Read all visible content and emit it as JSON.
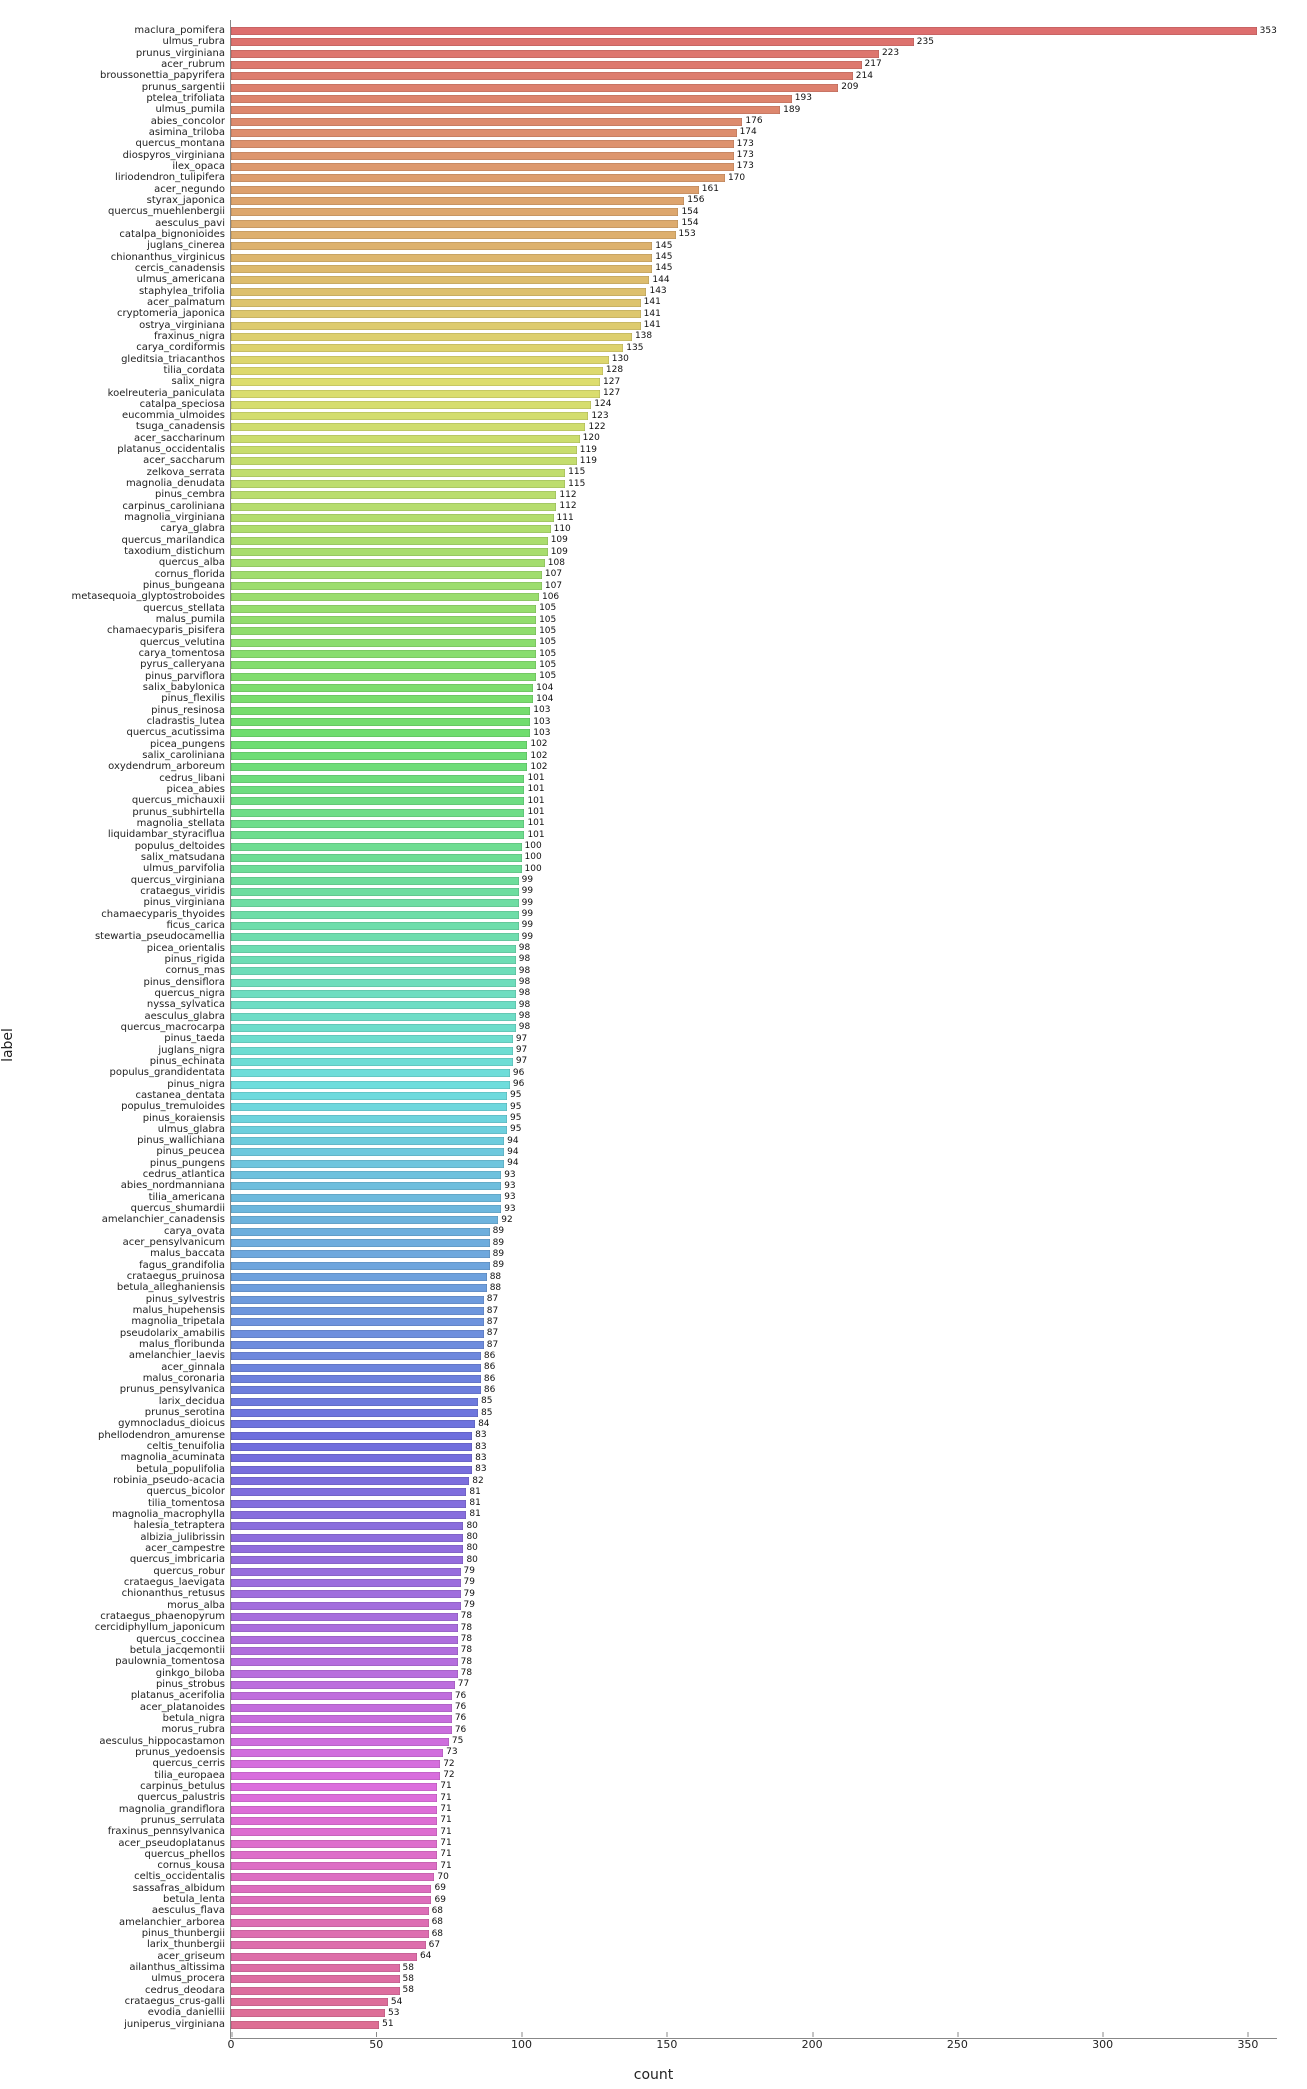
{
  "axis": {
    "xlabel": "count",
    "ylabel": "label",
    "x_ticks": [
      0,
      50,
      100,
      150,
      200,
      250,
      300,
      350
    ],
    "x_max": 360
  },
  "chart_data": {
    "type": "bar",
    "orientation": "horizontal",
    "title": "",
    "xlabel": "count",
    "ylabel": "label",
    "xlim": [
      0,
      360
    ],
    "categories": [
      "maclura_pomifera",
      "ulmus_rubra",
      "prunus_virginiana",
      "acer_rubrum",
      "broussonettia_papyrifera",
      "prunus_sargentii",
      "ptelea_trifoliata",
      "ulmus_pumila",
      "abies_concolor",
      "asimina_triloba",
      "quercus_montana",
      "diospyros_virginiana",
      "ilex_opaca",
      "liriodendron_tulipifera",
      "acer_negundo",
      "styrax_japonica",
      "quercus_muehlenbergii",
      "aesculus_pavi",
      "catalpa_bignonioides",
      "juglans_cinerea",
      "chionanthus_virginicus",
      "cercis_canadensis",
      "ulmus_americana",
      "staphylea_trifolia",
      "acer_palmatum",
      "cryptomeria_japonica",
      "ostrya_virginiana",
      "fraxinus_nigra",
      "carya_cordiformis",
      "gleditsia_triacanthos",
      "tilia_cordata",
      "salix_nigra",
      "koelreuteria_paniculata",
      "catalpa_speciosa",
      "eucommia_ulmoides",
      "tsuga_canadensis",
      "acer_saccharinum",
      "platanus_occidentalis",
      "acer_saccharum",
      "zelkova_serrata",
      "magnolia_denudata",
      "pinus_cembra",
      "carpinus_caroliniana",
      "magnolia_virginiana",
      "carya_glabra",
      "quercus_marilandica",
      "taxodium_distichum",
      "quercus_alba",
      "cornus_florida",
      "pinus_bungeana",
      "metasequoia_glyptostroboides",
      "quercus_stellata",
      "malus_pumila",
      "chamaecyparis_pisifera",
      "quercus_velutina",
      "carya_tomentosa",
      "pyrus_calleryana",
      "pinus_parviflora",
      "salix_babylonica",
      "pinus_flexilis",
      "pinus_resinosa",
      "cladrastis_lutea",
      "quercus_acutissima",
      "picea_pungens",
      "salix_caroliniana",
      "oxydendrum_arboreum",
      "cedrus_libani",
      "picea_abies",
      "quercus_michauxii",
      "prunus_subhirtella",
      "magnolia_stellata",
      "liquidambar_styraciflua",
      "populus_deltoides",
      "salix_matsudana",
      "ulmus_parvifolia",
      "quercus_virginiana",
      "crataegus_viridis",
      "pinus_virginiana",
      "chamaecyparis_thyoides",
      "ficus_carica",
      "stewartia_pseudocamellia",
      "picea_orientalis",
      "pinus_rigida",
      "cornus_mas",
      "pinus_densiflora",
      "quercus_nigra",
      "nyssa_sylvatica",
      "aesculus_glabra",
      "quercus_macrocarpa",
      "pinus_taeda",
      "juglans_nigra",
      "pinus_echinata",
      "populus_grandidentata",
      "pinus_nigra",
      "castanea_dentata",
      "populus_tremuloides",
      "pinus_koraiensis",
      "ulmus_glabra",
      "pinus_wallichiana",
      "pinus_peucea",
      "pinus_pungens",
      "cedrus_atlantica",
      "abies_nordmanniana",
      "tilia_americana",
      "quercus_shumardii",
      "amelanchier_canadensis",
      "carya_ovata",
      "acer_pensylvanicum",
      "malus_baccata",
      "fagus_grandifolia",
      "crataegus_pruinosa",
      "betula_alleghaniensis",
      "pinus_sylvestris",
      "malus_hupehensis",
      "magnolia_tripetala",
      "pseudolarix_amabilis",
      "malus_floribunda",
      "amelanchier_laevis",
      "acer_ginnala",
      "malus_coronaria",
      "prunus_pensylvanica",
      "larix_decidua",
      "prunus_serotina",
      "gymnocladus_dioicus",
      "phellodendron_amurense",
      "celtis_tenuifolia",
      "magnolia_acuminata",
      "betula_populifolia",
      "robinia_pseudo-acacia",
      "quercus_bicolor",
      "tilia_tomentosa",
      "magnolia_macrophylla",
      "halesia_tetraptera",
      "albizia_julibrissin",
      "acer_campestre",
      "quercus_imbricaria",
      "quercus_robur",
      "crataegus_laevigata",
      "chionanthus_retusus",
      "morus_alba",
      "crataegus_phaenopyrum",
      "cercidiphyllum_japonicum",
      "quercus_coccinea",
      "betula_jacqemontii",
      "paulownia_tomentosa",
      "ginkgo_biloba",
      "pinus_strobus",
      "platanus_acerifolia",
      "acer_platanoides",
      "betula_nigra",
      "morus_rubra",
      "aesculus_hippocastamon",
      "prunus_yedoensis",
      "quercus_cerris",
      "tilia_europaea",
      "carpinus_betulus",
      "quercus_palustris",
      "magnolia_grandiflora",
      "prunus_serrulata",
      "fraxinus_pennsylvanica",
      "acer_pseudoplatanus",
      "quercus_phellos",
      "cornus_kousa",
      "celtis_occidentalis",
      "sassafras_albidum",
      "betula_lenta",
      "aesculus_flava",
      "amelanchier_arborea",
      "pinus_thunbergii",
      "larix_thunbergii",
      "acer_griseum",
      "ailanthus_altissima",
      "ulmus_procera",
      "cedrus_deodara",
      "crataegus_crus-galli",
      "evodia_daniellii",
      "juniperus_virginiana"
    ],
    "values": [
      353,
      235,
      223,
      217,
      214,
      209,
      193,
      189,
      176,
      174,
      173,
      173,
      173,
      170,
      161,
      156,
      154,
      154,
      153,
      145,
      145,
      145,
      144,
      143,
      141,
      141,
      141,
      138,
      135,
      130,
      128,
      127,
      127,
      124,
      123,
      122,
      120,
      119,
      119,
      115,
      115,
      112,
      112,
      111,
      110,
      109,
      109,
      108,
      107,
      107,
      106,
      105,
      105,
      105,
      105,
      105,
      105,
      105,
      104,
      104,
      103,
      103,
      103,
      102,
      102,
      102,
      101,
      101,
      101,
      101,
      101,
      101,
      100,
      100,
      100,
      99,
      99,
      99,
      99,
      99,
      99,
      98,
      98,
      98,
      98,
      98,
      98,
      98,
      98,
      97,
      97,
      97,
      96,
      96,
      95,
      95,
      95,
      95,
      94,
      94,
      94,
      93,
      93,
      93,
      93,
      92,
      89,
      89,
      89,
      89,
      88,
      88,
      87,
      87,
      87,
      87,
      87,
      86,
      86,
      86,
      86,
      85,
      85,
      84,
      83,
      83,
      83,
      83,
      82,
      81,
      81,
      81,
      80,
      80,
      80,
      80,
      79,
      79,
      79,
      79,
      78,
      78,
      78,
      78,
      78,
      78,
      77,
      76,
      76,
      76,
      76,
      75,
      73,
      72,
      72,
      71,
      71,
      71,
      71,
      71,
      71,
      71,
      71,
      70,
      69,
      69,
      68,
      68,
      68,
      67,
      64,
      58,
      58,
      58,
      54,
      53,
      51
    ]
  }
}
